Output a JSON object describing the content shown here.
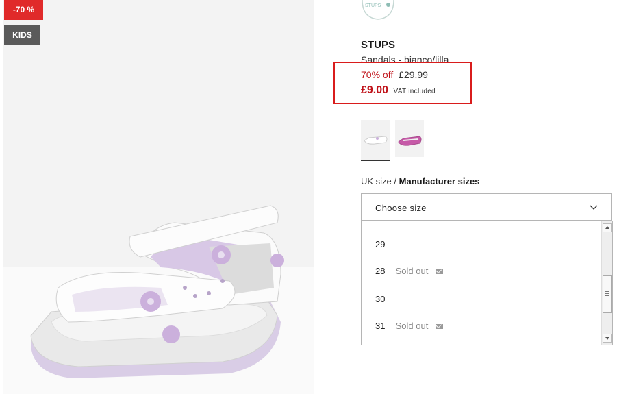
{
  "badges": {
    "discount": "-70 %",
    "category": "KIDS"
  },
  "brand": {
    "logo_text": "STUPS",
    "name": "STUPS"
  },
  "product": {
    "name": "Sandals - bianco/lilla",
    "discount_pct": "70% off",
    "old_price": "£29.99",
    "new_price": "£9.00",
    "vat_note": "VAT included"
  },
  "sizes": {
    "label_primary": "UK size",
    "label_separator": "/",
    "label_secondary": "Manufacturer sizes",
    "placeholder": "Choose size",
    "options": [
      {
        "size": "29",
        "status": ""
      },
      {
        "size": "28",
        "status": "Sold out"
      },
      {
        "size": "30",
        "status": ""
      },
      {
        "size": "31",
        "status": "Sold out"
      }
    ]
  },
  "colors": {
    "sale_red": "#c0131a",
    "badge_red": "#e02a2a",
    "badge_grey": "#5a5a5a",
    "highlight_box": "#d91c1c"
  }
}
